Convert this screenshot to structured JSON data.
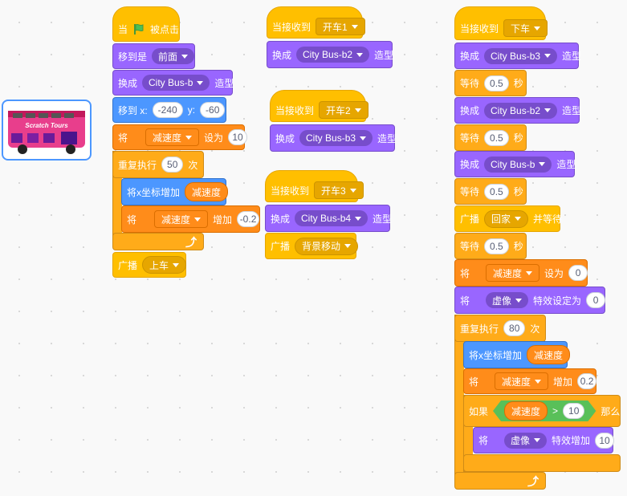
{
  "sprite": {
    "text": "Scratch Tours"
  },
  "s1": {
    "when_pre": "当",
    "when_post": "被点击",
    "goto": "移到是",
    "goto_opt": "前面",
    "sw": "换成",
    "sw_opt": "City Bus-b",
    "sw_post": "造型",
    "moveto": "移到 x:",
    "x": "-240",
    "ylab": "y:",
    "y": "-60",
    "set_pre": "将",
    "set_var": "减速度",
    "set_mid": "设为",
    "set_val": "10",
    "rep": "重复执行",
    "rep_n": "50",
    "rep_post": "次",
    "chx": "将x坐标增加",
    "chx_var": "减速度",
    "ch_pre": "将",
    "ch_var": "减速度",
    "ch_mid": "增加",
    "ch_val": "-0.2",
    "bc": "广播",
    "bc_opt": "上车"
  },
  "s2": {
    "when": "当接收到",
    "msg": "开车1",
    "sw": "换成",
    "opt": "City Bus-b2",
    "post": "造型"
  },
  "s3": {
    "when": "当接收到",
    "msg": "开车2",
    "sw": "换成",
    "opt": "City Bus-b3",
    "post": "造型"
  },
  "s4": {
    "when": "当接收到",
    "msg": "开车3",
    "sw": "换成",
    "opt": "City Bus-b4",
    "post": "造型",
    "bc": "广播",
    "bc_opt": "背景移动"
  },
  "s5": {
    "when": "当接收到",
    "msg": "下车",
    "sw1": "换成",
    "o1": "City Bus-b3",
    "p1": "造型",
    "w1": "等待",
    "w1v": "0.5",
    "w1s": "秒",
    "sw2": "换成",
    "o2": "City Bus-b2",
    "p2": "造型",
    "w2": "等待",
    "w2v": "0.5",
    "w2s": "秒",
    "sw3": "换成",
    "o3": "City Bus-b",
    "p3": "造型",
    "w3": "等待",
    "w3v": "0.5",
    "w3s": "秒",
    "bcw": "广播",
    "bcw_opt": "回家",
    "bcw_post": "并等待",
    "w4": "等待",
    "w4v": "0.5",
    "w4s": "秒",
    "set_pre": "将",
    "set_var": "减速度",
    "set_mid": "设为",
    "set_val": "0",
    "eff_pre": "将",
    "eff_opt": "虚像",
    "eff_mid": "特效设定为",
    "eff_val": "0",
    "rep": "重复执行",
    "rep_n": "80",
    "rep_post": "次",
    "chx": "将x坐标增加",
    "chx_var": "减速度",
    "ch_pre": "将",
    "ch_var": "减速度",
    "ch_mid": "增加",
    "ch_val": "0.2",
    "if": "如果",
    "if_var": "减速度",
    "gt": ">",
    "if_val": "10",
    "then": "那么",
    "eff2_pre": "将",
    "eff2_opt": "虚像",
    "eff2_mid": "特效增加",
    "eff2_val": "10"
  }
}
